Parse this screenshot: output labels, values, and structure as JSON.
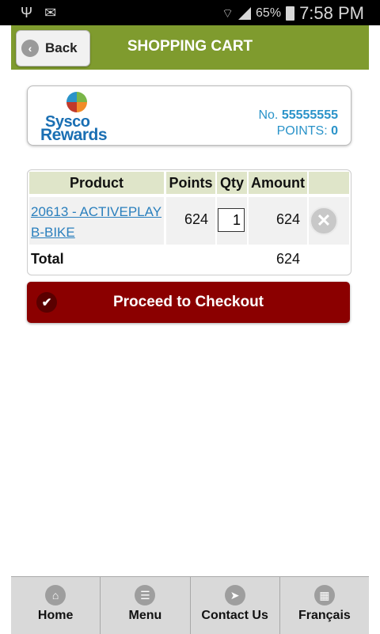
{
  "status": {
    "battery": "65%",
    "time": "7:58 PM"
  },
  "header": {
    "back_label": "Back",
    "title": "SHOPPING CART"
  },
  "card": {
    "logo_line1": "Sysco",
    "logo_line2": "Rewards",
    "number_label": "No.",
    "number_value": "55555555",
    "points_label": "POINTS:",
    "points_value": "0"
  },
  "cart": {
    "columns": [
      "Product",
      "Points",
      "Qty",
      "Amount"
    ],
    "rows": [
      {
        "product_line1": "20613 - ACTIVEPLAY",
        "product_line2": "B-BIKE",
        "points": "624",
        "qty": "1",
        "amount": "624"
      }
    ],
    "total_label": "Total",
    "total_value": "624"
  },
  "checkout_label": "Proceed to Checkout",
  "footer": {
    "tabs": [
      {
        "label": "Home",
        "icon": "home-icon"
      },
      {
        "label": "Menu",
        "icon": "menu-icon"
      },
      {
        "label": "Contact Us",
        "icon": "location-arrow-icon"
      },
      {
        "label": "Français",
        "icon": "grid-icon"
      }
    ]
  },
  "colors": {
    "header_bg": "#7f9b2e",
    "checkout_bg": "#8b0000",
    "link": "#2a7fbd",
    "points_text": "#2a93c9"
  }
}
